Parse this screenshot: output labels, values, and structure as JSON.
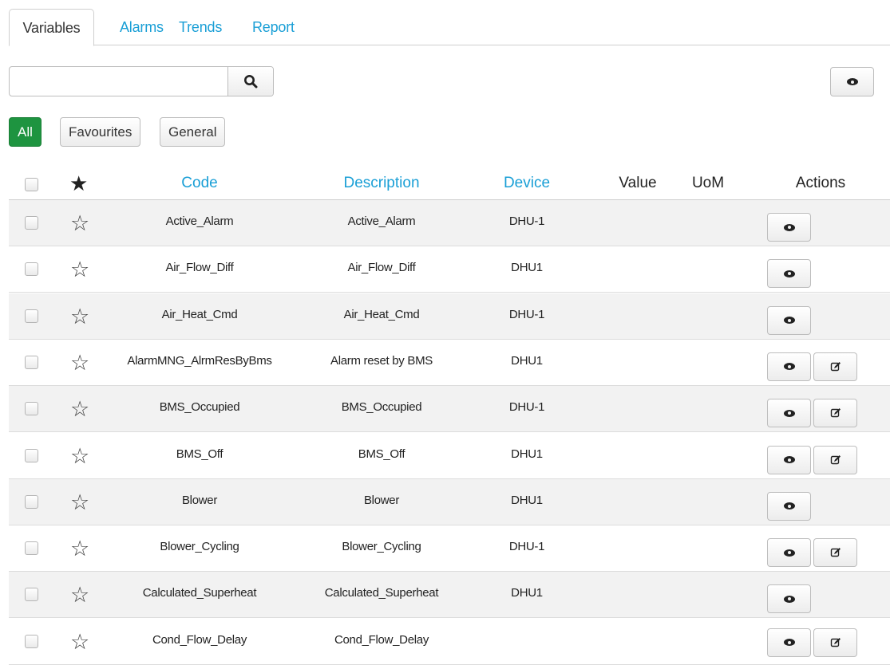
{
  "tabs": [
    {
      "label": "Variables",
      "active": true
    },
    {
      "label": "Alarms"
    },
    {
      "label": "Trends"
    },
    {
      "label": "Report"
    }
  ],
  "search": {
    "value": "",
    "placeholder": ""
  },
  "filters": [
    {
      "label": "All",
      "active": true
    },
    {
      "label": "Favourites"
    },
    {
      "label": "General"
    }
  ],
  "table": {
    "headers": {
      "favourite": "★",
      "code": "Code",
      "description": "Description",
      "device": "Device",
      "value": "Value",
      "uom": "UoM",
      "actions": "Actions"
    },
    "star_empty": "☆",
    "rows": [
      {
        "code": "Active_Alarm",
        "description": "Active_Alarm",
        "device": "DHU-1",
        "value": "",
        "uom": "",
        "editable": false
      },
      {
        "code": "Air_Flow_Diff",
        "description": "Air_Flow_Diff",
        "device": "DHU1",
        "value": "",
        "uom": "",
        "editable": false
      },
      {
        "code": "Air_Heat_Cmd",
        "description": "Air_Heat_Cmd",
        "device": "DHU-1",
        "value": "",
        "uom": "",
        "editable": false
      },
      {
        "code": "AlarmMNG_AlrmResByBms",
        "description": "Alarm reset by BMS",
        "device": "DHU1",
        "value": "",
        "uom": "",
        "editable": true
      },
      {
        "code": "BMS_Occupied",
        "description": "BMS_Occupied",
        "device": "DHU-1",
        "value": "",
        "uom": "",
        "editable": true
      },
      {
        "code": "BMS_Off",
        "description": "BMS_Off",
        "device": "DHU1",
        "value": "",
        "uom": "",
        "editable": true
      },
      {
        "code": "Blower",
        "description": "Blower",
        "device": "DHU1",
        "value": "",
        "uom": "",
        "editable": false
      },
      {
        "code": "Blower_Cycling",
        "description": "Blower_Cycling",
        "device": "DHU-1",
        "value": "",
        "uom": "",
        "editable": true
      },
      {
        "code": "Calculated_Superheat",
        "description": "Calculated_Superheat",
        "device": "DHU1",
        "value": "",
        "uom": "",
        "editable": false
      },
      {
        "code": "Cond_Flow_Delay",
        "description": "Cond_Flow_Delay",
        "device": "",
        "value": "",
        "uom": "",
        "editable": true
      }
    ]
  },
  "icons": {
    "search": "search-icon",
    "view": "eye-icon",
    "edit": "edit-icon"
  },
  "colors": {
    "accent": "#1a9fd6",
    "active_filter": "#1e9440",
    "alt_row": "#f2f2f2"
  }
}
